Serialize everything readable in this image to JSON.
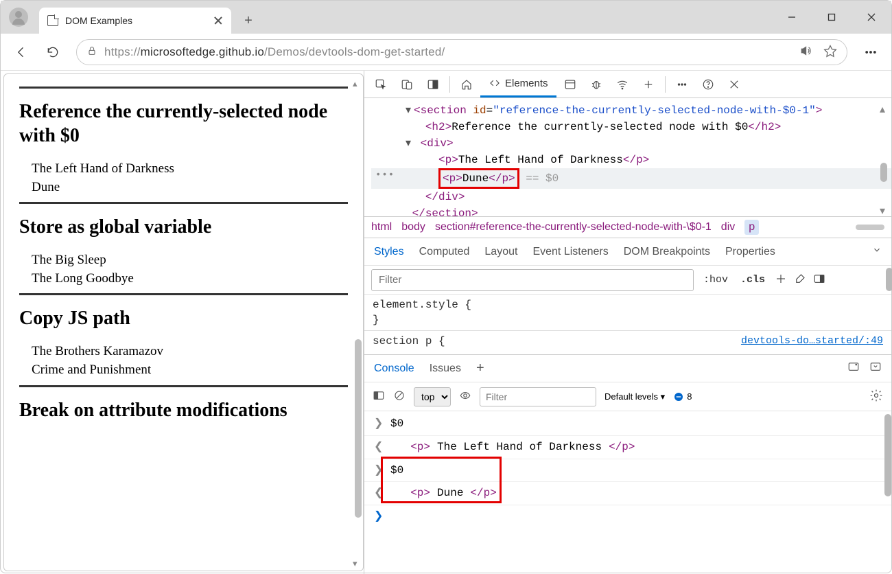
{
  "tab": {
    "title": "DOM Examples"
  },
  "url": {
    "prefix": "https://",
    "host": "microsoftedge.github.io",
    "path": "/Demos/devtools-dom-get-started/"
  },
  "page": {
    "sections": [
      {
        "title": "Reference the currently-selected node with $0",
        "items": [
          "The Left Hand of Darkness",
          "Dune"
        ]
      },
      {
        "title": "Store as global variable",
        "items": [
          "The Big Sleep",
          "The Long Goodbye"
        ]
      },
      {
        "title": "Copy JS path",
        "items": [
          "The Brothers Karamazov",
          "Crime and Punishment"
        ]
      },
      {
        "title": "Break on attribute modifications",
        "items": []
      }
    ]
  },
  "devtools": {
    "tabs": {
      "elements": "Elements"
    },
    "tree": {
      "section_open": "<section id=\"reference-the-currently-selected-node-with-$0-1\">",
      "h2": "Reference the currently-selected node with $0",
      "p1": "The Left Hand of Darkness",
      "p2": "Dune",
      "dollar": "== $0"
    },
    "crumbs": [
      "html",
      "body",
      "section#reference-the-currently-selected-node-with-\\$0-1",
      "div",
      "p"
    ],
    "styles_tabs": [
      "Styles",
      "Computed",
      "Layout",
      "Event Listeners",
      "DOM Breakpoints",
      "Properties"
    ],
    "filter_placeholder": "Filter",
    "hov": ":hov",
    "cls": ".cls",
    "styles": {
      "element_style": "element.style {",
      "brace": "}",
      "section_rule": "section p {",
      "link": "devtools-do…started/:49"
    },
    "drawer_tabs": [
      "Console",
      "Issues"
    ],
    "console_toolbar": {
      "context": "top",
      "filter_placeholder": "Filter",
      "levels": "Default levels",
      "issues": "8"
    },
    "console": {
      "l1": "$0",
      "l2_text": "The Left Hand of Darkness",
      "l3": "$0",
      "l4_text": "Dune"
    }
  }
}
